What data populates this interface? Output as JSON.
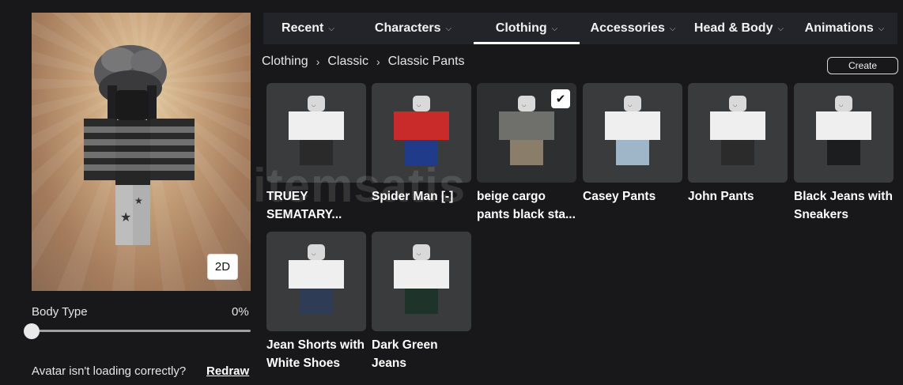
{
  "preview": {
    "view_toggle": "2D"
  },
  "body_type": {
    "label": "Body Type",
    "value": "0%",
    "level": 0
  },
  "footer": {
    "message": "Avatar isn't loading correctly?",
    "redraw": "Redraw"
  },
  "tabs": [
    {
      "label": "Recent",
      "active": false
    },
    {
      "label": "Characters",
      "active": false
    },
    {
      "label": "Clothing",
      "active": true
    },
    {
      "label": "Accessories",
      "active": false
    },
    {
      "label": "Head & Body",
      "active": false
    },
    {
      "label": "Animations",
      "active": false
    }
  ],
  "breadcrumb": [
    "Clothing",
    "Classic",
    "Classic Pants"
  ],
  "create_label": "Create",
  "watermark": "itemsatis",
  "items": [
    {
      "name_line1": "TRUEY",
      "name_line2": "SEMATARY...",
      "selected": false,
      "pants_color": "#2a2a2a",
      "torso_color": "#efefef"
    },
    {
      "name_line1": "Spider Man [-]",
      "name_line2": "",
      "selected": false,
      "pants_color": "#1f3b8a",
      "torso_color": "#c92a2a"
    },
    {
      "name_line1": "beige cargo",
      "name_line2": "pants black sta...",
      "selected": true,
      "pants_color": "#8a7e6a",
      "torso_color": "#6f6f6c"
    },
    {
      "name_line1": "Casey Pants",
      "name_line2": "",
      "selected": false,
      "pants_color": "#9fb6c9",
      "torso_color": "#efefef"
    },
    {
      "name_line1": "John Pants",
      "name_line2": "",
      "selected": false,
      "pants_color": "#2b2b2b",
      "torso_color": "#efefef"
    },
    {
      "name_line1": "Black Jeans with",
      "name_line2": "Sneakers",
      "selected": false,
      "pants_color": "#1b1d1e",
      "torso_color": "#efefef"
    },
    {
      "name_line1": "Jean Shorts with",
      "name_line2": "White Shoes",
      "selected": false,
      "pants_color": "#2e3d55",
      "torso_color": "#efefef"
    },
    {
      "name_line1": "Dark Green",
      "name_line2": "Jeans",
      "selected": false,
      "pants_color": "#1e3329",
      "torso_color": "#efefef"
    }
  ]
}
